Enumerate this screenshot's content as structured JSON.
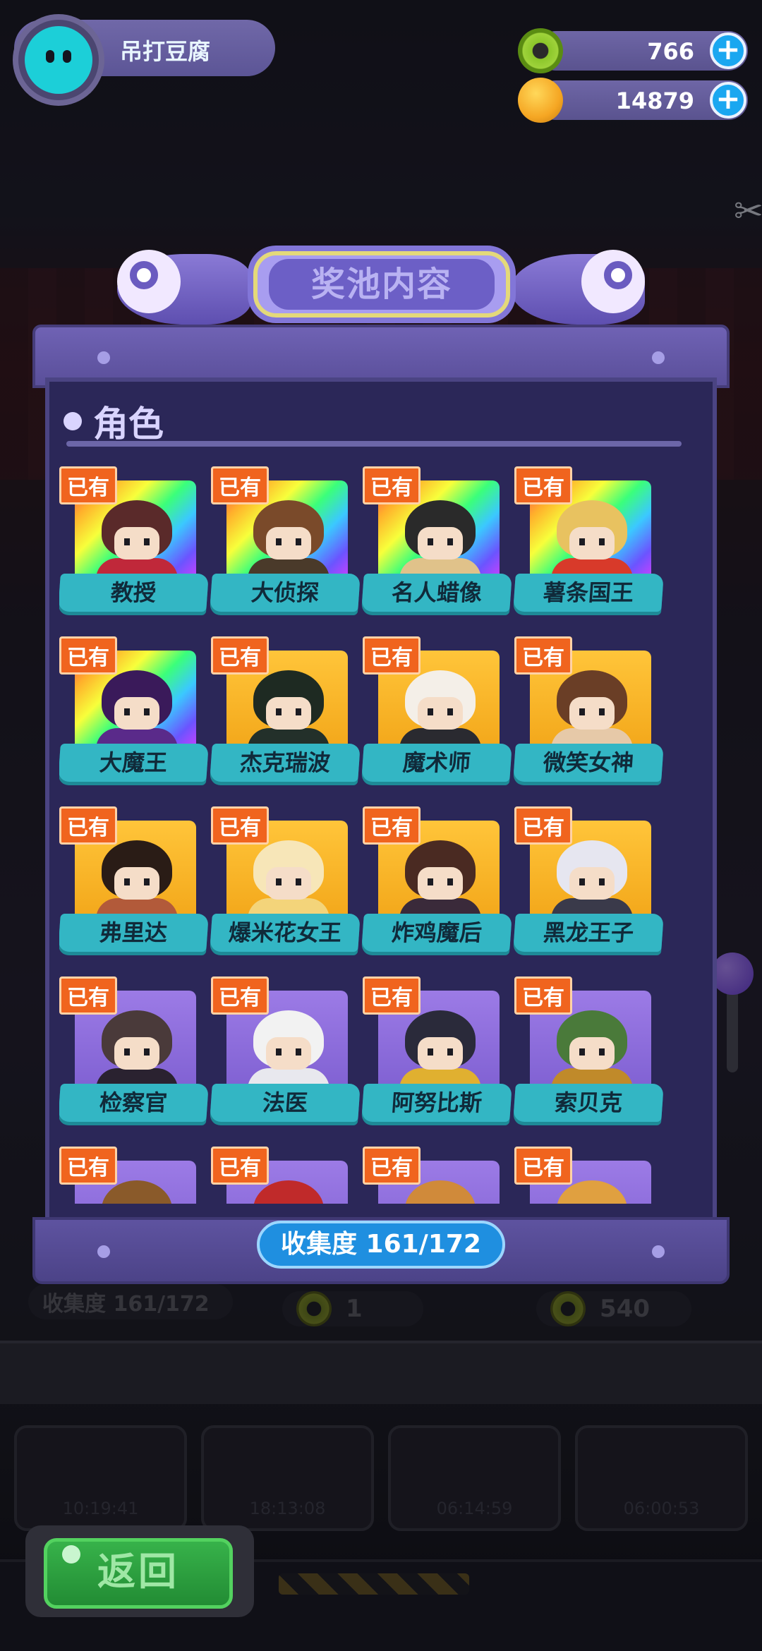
{
  "header": {
    "player_name": "吊打豆腐",
    "currencies": [
      {
        "icon": "donut-icon",
        "value": "766"
      },
      {
        "icon": "planet-icon",
        "value": "14879"
      }
    ]
  },
  "modal": {
    "title": "奖池内容",
    "section_title": "角色",
    "owned_label": "已有",
    "collection": "收集度 161/172",
    "characters": [
      {
        "name": "教授",
        "rarity": "rainbow",
        "hair": "#5a2a2a",
        "body": "#c0283a"
      },
      {
        "name": "大侦探",
        "rarity": "rainbow",
        "hair": "#7a4a2a",
        "body": "#4a3a2a"
      },
      {
        "name": "名人蜡像",
        "rarity": "rainbow",
        "hair": "#2a2a2a",
        "body": "#e0c28a"
      },
      {
        "name": "薯条国王",
        "rarity": "rainbow",
        "hair": "#e8c260",
        "body": "#d83a2a"
      },
      {
        "name": "大魔王",
        "rarity": "rainbow",
        "hair": "#3a1a5a",
        "body": "#5a2a8a"
      },
      {
        "name": "杰克瑞波",
        "rarity": "gold",
        "hair": "#1e2a22",
        "body": "#23302a"
      },
      {
        "name": "魔术师",
        "rarity": "gold",
        "hair": "#f4efe8",
        "body": "#2a2a30"
      },
      {
        "name": "微笑女神",
        "rarity": "gold",
        "hair": "#6a3e26",
        "body": "#e6c9a8"
      },
      {
        "name": "弗里达",
        "rarity": "gold",
        "hair": "#2a1c16",
        "body": "#b25a3a"
      },
      {
        "name": "爆米花女王",
        "rarity": "gold",
        "hair": "#f7e6b8",
        "body": "#f3d47a"
      },
      {
        "name": "炸鸡魔后",
        "rarity": "gold",
        "hair": "#4a2a22",
        "body": "#3a2a3a"
      },
      {
        "name": "黑龙王子",
        "rarity": "gold",
        "hair": "#e6e6f0",
        "body": "#3a3a4a"
      },
      {
        "name": "检察官",
        "rarity": "purple",
        "hair": "#4a3a3a",
        "body": "#2a2230"
      },
      {
        "name": "法医",
        "rarity": "purple",
        "hair": "#f2f2f2",
        "body": "#e8e8ee"
      },
      {
        "name": "阿努比斯",
        "rarity": "purple",
        "hair": "#2a2a3a",
        "body": "#e0b030"
      },
      {
        "name": "索贝克",
        "rarity": "purple",
        "hair": "#4a7a3a",
        "body": "#c08a2a"
      },
      {
        "name": "",
        "rarity": "purple",
        "hair": "#8a5a2a",
        "body": "#8a5a2a"
      },
      {
        "name": "",
        "rarity": "purple",
        "hair": "#c02a2a",
        "body": "#6a2a2a"
      },
      {
        "name": "",
        "rarity": "purple",
        "hair": "#d08a3a",
        "body": "#d08a3a"
      },
      {
        "name": "",
        "rarity": "purple",
        "hair": "#e0a040",
        "body": "#e0a040"
      }
    ]
  },
  "background": {
    "collection_echo": "收集度 161/172",
    "item_count": "1",
    "donut_count": "540",
    "timers": [
      "10:19:41",
      "18:13:08",
      "06:14:59",
      "06:00:53"
    ]
  },
  "back_button": "返回",
  "colors": {
    "owned_tag": "#f0641e",
    "name_ribbon": "#33b6c4",
    "modal_body": "#2b2758",
    "back_button": "#2ea140"
  }
}
